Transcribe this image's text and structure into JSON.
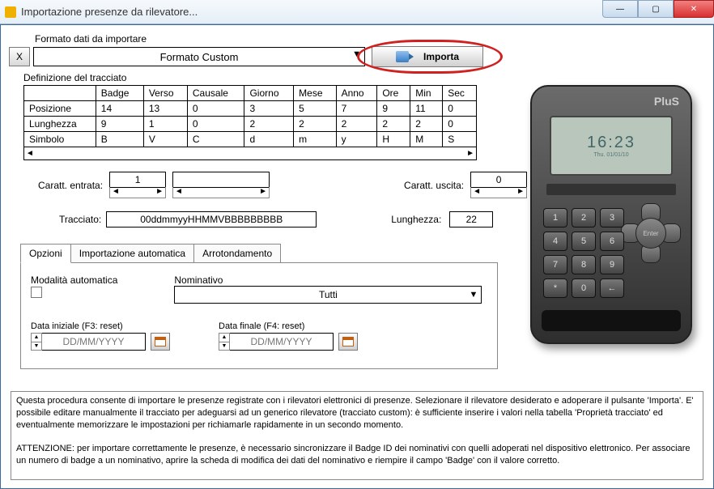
{
  "window": {
    "title": "Importazione presenze da rilevatore...",
    "min_label": "—",
    "max_label": "▢",
    "close_label": "✕"
  },
  "format": {
    "label": "Formato dati da importare",
    "x_label": "X",
    "selected": "Formato Custom"
  },
  "import_button": "Importa",
  "tracciato_section_label": "Definizione del tracciato",
  "table": {
    "headers": [
      "",
      "Badge",
      "Verso",
      "Causale",
      "Giorno",
      "Mese",
      "Anno",
      "Ore",
      "Min",
      "Sec"
    ],
    "rows": [
      {
        "label": "Posizione",
        "cells": [
          "14",
          "13",
          "0",
          "3",
          "5",
          "7",
          "9",
          "11",
          "0"
        ]
      },
      {
        "label": "Lunghezza",
        "cells": [
          "9",
          "1",
          "0",
          "2",
          "2",
          "2",
          "2",
          "2",
          "0"
        ]
      },
      {
        "label": "Simbolo",
        "cells": [
          "B",
          "V",
          "C",
          "d",
          "m",
          "y",
          "H",
          "M",
          "S"
        ]
      }
    ],
    "scroll_left": "◄",
    "scroll_right": "►"
  },
  "caratt": {
    "entrata_label": "Caratt. entrata:",
    "entrata_value": "1",
    "uscita_label": "Caratt. uscita:",
    "uscita_value": "0"
  },
  "tracciato": {
    "label": "Tracciato:",
    "value": "00ddmmyyHHMMVBBBBBBBBB",
    "lung_label": "Lunghezza:",
    "lung_value": "22"
  },
  "tabs": {
    "opzioni": "Opzioni",
    "import_auto": "Importazione automatica",
    "arrot": "Arrotondamento"
  },
  "options": {
    "modalita_label": "Modalità automatica",
    "nominativo_label": "Nominativo",
    "nominativo_value": "Tutti",
    "data_iniziale_label": "Data iniziale (F3: reset)",
    "data_finale_label": "Data finale (F4: reset)",
    "date_placeholder": "DD/MM/YYYY"
  },
  "info": {
    "p1": "Questa procedura consente di importare le presenze registrate con i rilevatori elettronici di presenze. Selezionare il rilevatore desiderato e adoperare il pulsante 'Importa'. E' possibile editare manualmente il tracciato per adeguarsi ad un generico rilevatore (tracciato custom): è sufficiente inserire i valori nella tabella 'Proprietà tracciato' ed eventualmente memorizzare le impostazioni per richiamarle rapidamente in un secondo momento.",
    "p2": "ATTENZIONE: per importare correttamente le presenze, è necessario sincronizzare il Badge ID dei nominativi con quelli adoperati nel dispositivo elettronico. Per associare un numero di badge a un nominativo, aprire la scheda di modifica dei dati del nominativo e riempire il campo 'Badge' con il valore corretto."
  },
  "device": {
    "brand": "PluS",
    "time": "16:23",
    "sub": "Thu. 01/01/10",
    "enter": "Enter",
    "keys": [
      "1",
      "2",
      "3",
      "4",
      "5",
      "6",
      "7",
      "8",
      "9",
      "*",
      "0",
      "←"
    ]
  }
}
